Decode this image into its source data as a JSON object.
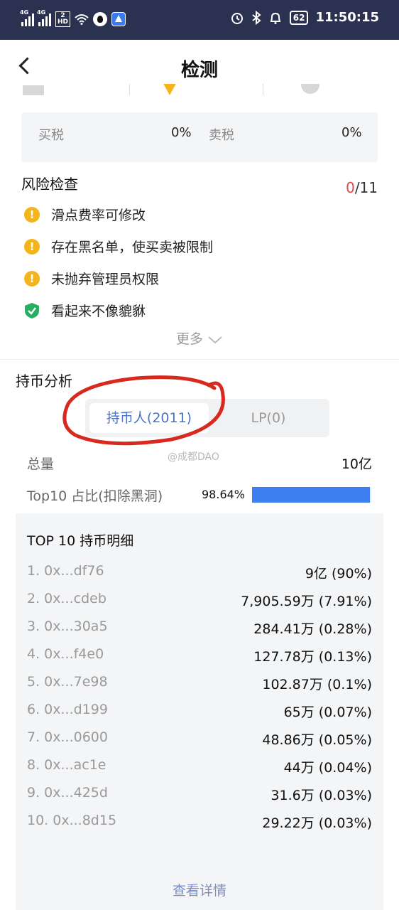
{
  "status_bar": {
    "net1": "4G",
    "net2": "4G",
    "hd_top": "2",
    "hd_bottom": "HD",
    "battery": "62",
    "time": "11:50:15"
  },
  "header": {
    "title": "检测"
  },
  "tax": {
    "buy_label": "买税",
    "buy_value": "0%",
    "sell_label": "卖税",
    "sell_value": "0%"
  },
  "risk": {
    "title": "风险检查",
    "count_found": "0",
    "count_total": "/11",
    "items": [
      {
        "label": "滑点费率可修改",
        "status": "warning"
      },
      {
        "label": "存在黑名单，使买卖被限制",
        "status": "warning"
      },
      {
        "label": "未抛弃管理员权限",
        "status": "warning"
      },
      {
        "label": "看起来不像貔貅",
        "status": "safe"
      }
    ],
    "more_label": "更多"
  },
  "holdings": {
    "title": "持币分析",
    "tabs": [
      {
        "label": "持币人(2011)",
        "active": true
      },
      {
        "label": "LP(0)",
        "active": false
      }
    ],
    "watermark": "@成都DAO",
    "total_label": "总量",
    "total_value": "10亿",
    "top10_label": "Top10 占比(扣除黑洞)",
    "top10_pct": "98.64%",
    "top10_fraction": 0.9864
  },
  "detail": {
    "title": "TOP 10 持币明细",
    "rows": [
      {
        "addr": "1. 0x...df76",
        "amount": "9亿 (90%)"
      },
      {
        "addr": "2. 0x...cdeb",
        "amount": "7,905.59万 (7.91%)"
      },
      {
        "addr": "3. 0x...30a5",
        "amount": "284.41万 (0.28%)"
      },
      {
        "addr": "4. 0x...f4e0",
        "amount": "127.78万 (0.13%)"
      },
      {
        "addr": "5. 0x...7e98",
        "amount": "102.87万 (0.1%)"
      },
      {
        "addr": "6. 0x...d199",
        "amount": "65万 (0.07%)"
      },
      {
        "addr": "7. 0x...0600",
        "amount": "48.86万 (0.05%)"
      },
      {
        "addr": "8. 0x...ac1e",
        "amount": "44万 (0.04%)"
      },
      {
        "addr": "9. 0x...425d",
        "amount": "31.6万 (0.03%)"
      },
      {
        "addr": "10. 0x...8d15",
        "amount": "29.22万 (0.03%)"
      }
    ],
    "link_label": "查看详情"
  },
  "colors": {
    "status_bar_bg": "#2b3150",
    "warning": "#f4b41a",
    "safe": "#27ae60",
    "count_red": "#e04848",
    "bar_fill": "#3d7ef0",
    "tab_active_text": "#4a74c8"
  }
}
